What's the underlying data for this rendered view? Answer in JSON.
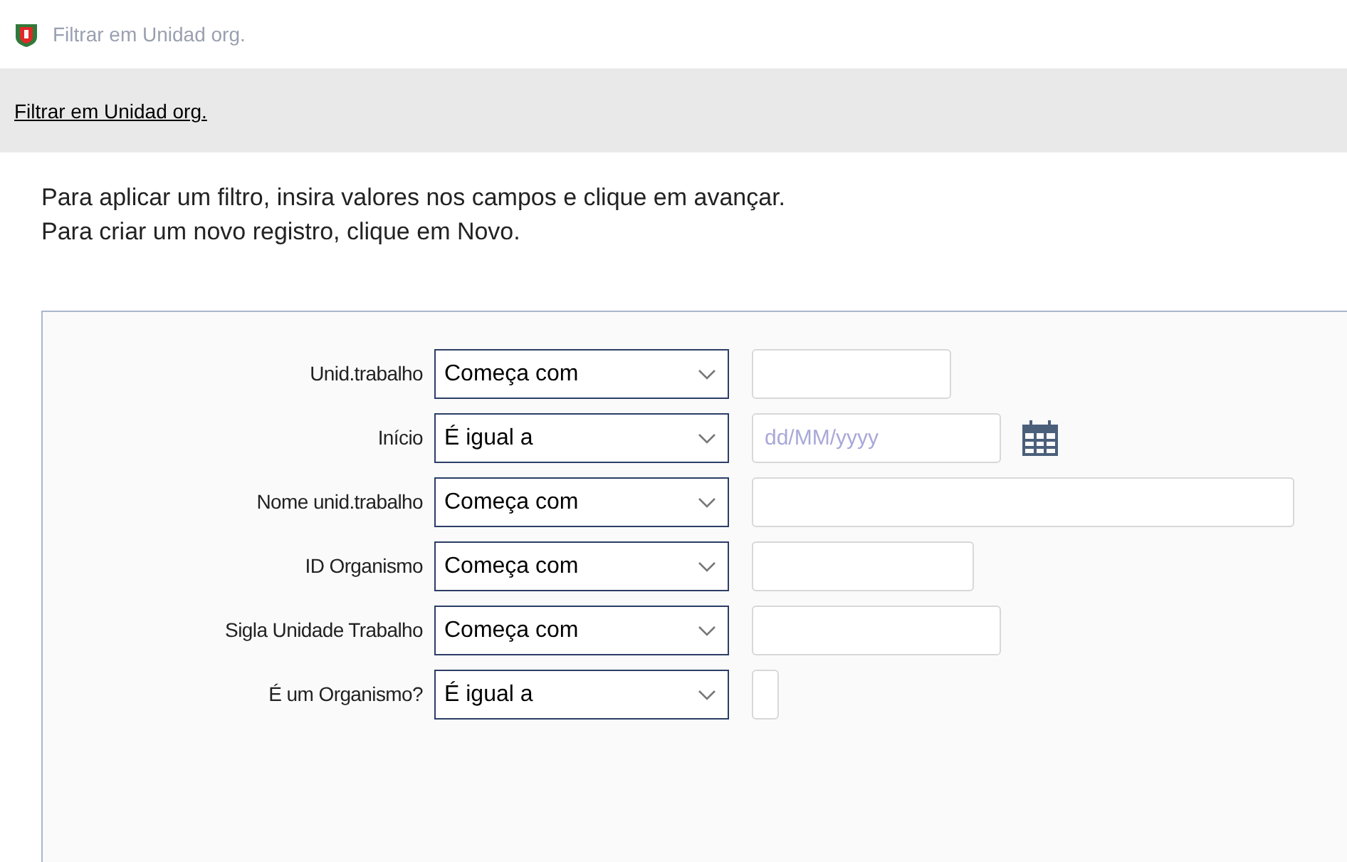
{
  "window": {
    "title": "Filtrar em Unidad org."
  },
  "breadcrumb": {
    "link": "Filtrar em Unidad org."
  },
  "instructions": [
    "Para aplicar um filtro, insira valores nos campos e clique em avançar.",
    "Para criar um novo registro, clique em Novo."
  ],
  "filters": [
    {
      "label": "Unid.trabalho",
      "operator": "Começa com",
      "kind": "text"
    },
    {
      "label": "Início",
      "operator": "É igual a",
      "kind": "date",
      "placeholder": "dd/MM/yyyy"
    },
    {
      "label": "Nome unid.trabalho",
      "operator": "Começa com",
      "kind": "text"
    },
    {
      "label": "ID Organismo",
      "operator": "Começa com",
      "kind": "text"
    },
    {
      "label": "Sigla Unidade Trabalho",
      "operator": "Começa com",
      "kind": "text"
    },
    {
      "label": "É um Organismo?",
      "operator": "É igual a",
      "kind": "flag"
    }
  ]
}
